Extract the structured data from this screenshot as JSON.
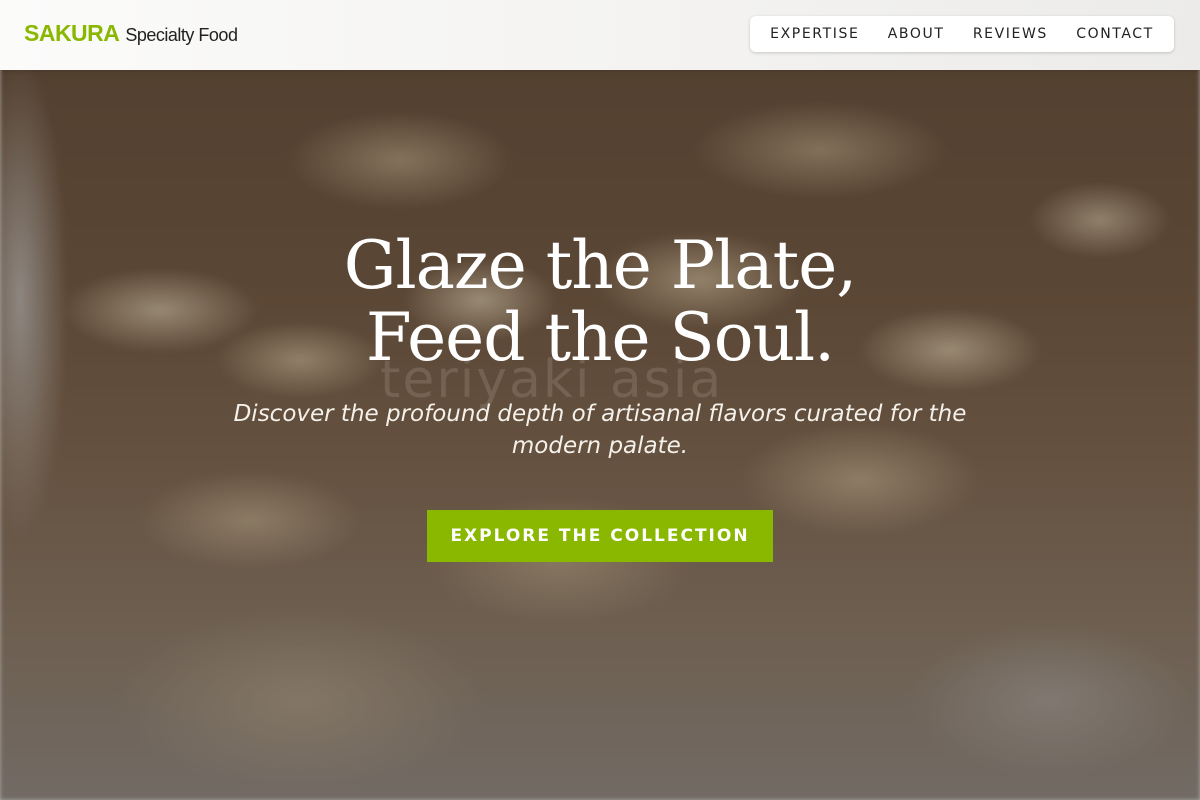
{
  "header": {
    "brand_name": "SAKURA",
    "brand_sub": "Specialty Food",
    "nav": [
      {
        "label": "EXPERTISE"
      },
      {
        "label": "ABOUT"
      },
      {
        "label": "REVIEWS"
      },
      {
        "label": "CONTACT"
      }
    ]
  },
  "hero": {
    "headline_line1": "Glaze the Plate,",
    "headline_line2": "Feed the Soul.",
    "tagline": "Discover the profound depth of artisanal flavors curated for the modern palate.",
    "cta_label": "EXPLORE THE COLLECTION",
    "watermark": "teriyaki asia"
  },
  "colors": {
    "accent": "#8ab800",
    "header_bg": "#f5f4f2",
    "text_dark": "#222222",
    "text_light": "#ffffff"
  }
}
